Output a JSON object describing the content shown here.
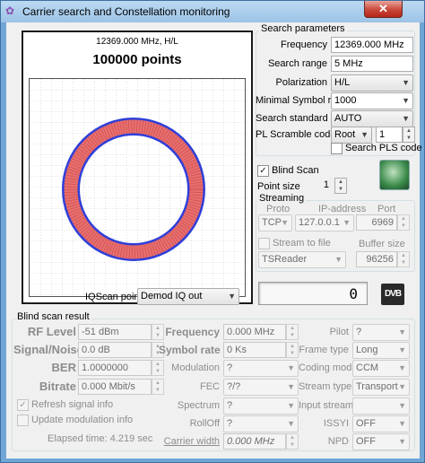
{
  "window": {
    "title": "Carrier search and Constellation monitoring",
    "close_label": "✕"
  },
  "plot": {
    "header": "12369.000 MHz, H/L",
    "points_label": "100000 points",
    "ring_color": "#e87070",
    "ring_edge_color": "#2f3fd8"
  },
  "search": {
    "title": "Search parameters",
    "frequency_label": "Frequency",
    "frequency_value": "12369.000 MHz",
    "range_label": "Search range",
    "range_value": "5 MHz",
    "polarization_label": "Polarization",
    "polarization_value": "H/L",
    "min_sr_label": "Minimal Symbol rate",
    "min_sr_value": "1000",
    "standard_label": "Search standard",
    "standard_value": "AUTO",
    "pls_code_label": "PL Scramble code",
    "pls_mode_value": "Root",
    "pls_code_value": "1",
    "search_pls_label": "Search PLS code"
  },
  "blind_scan": {
    "label": "Blind Scan",
    "checked": "✓",
    "point_size_label": "Point size",
    "point_size_value": "1"
  },
  "streaming": {
    "title": "Streaming",
    "proto_header": "Proto",
    "ip_header": "IP-address",
    "port_header": "Port",
    "proto_value": "TCP",
    "ip_value": "127.0.0.1",
    "port_value": "6969",
    "stream_to_file_label": "Stream to file",
    "buffer_size_label": "Buffer size",
    "file_format_value": "TSReader",
    "buffer_size_value": "96256"
  },
  "iqscan": {
    "label": "IQScan point",
    "value": "Demod IQ out"
  },
  "lcd": {
    "value": "0"
  },
  "dvb_logo": "DVB",
  "result": {
    "title": "Blind scan result",
    "rf_level_label": "RF Level",
    "rf_level_value": "-51 dBm",
    "snr_label": "Signal/Noise",
    "snr_value": "0.0 dB",
    "ber_label": "BER",
    "ber_value": "1.0000000",
    "bitrate_label": "Bitrate",
    "bitrate_value": "0.000 Mbit/s",
    "refresh_label": "Refresh signal info",
    "refresh_checked": "✓",
    "update_mod_label": "Update modulation info",
    "elapsed": "Elapsed time: 4.219 sec",
    "frequency_label": "Frequency",
    "frequency_value": "0.000 MHz",
    "symbol_rate_label": "Symbol rate",
    "symbol_rate_value": "0 Ks",
    "modulation_label": "Modulation",
    "modulation_value": "?",
    "fec_label": "FEC",
    "fec_value": "?/?",
    "spectrum_label": "Spectrum",
    "spectrum_value": "?",
    "rolloff_label": "RollOff",
    "rolloff_value": "?",
    "carrier_width_label": "Carrier width",
    "carrier_width_value": "0.000 MHz",
    "pilot_label": "Pilot",
    "pilot_value": "?",
    "frame_type_label": "Frame type",
    "frame_type_value": "Long",
    "coding_mode_label": "Coding mode",
    "coding_mode_value": "CCM",
    "stream_type_label": "Stream type",
    "stream_type_value": "Transport",
    "input_stream_label": "Input stream",
    "input_stream_value": "",
    "issyi_label": "ISSYI",
    "issyi_value": "OFF",
    "npd_label": "NPD",
    "npd_value": "OFF"
  }
}
